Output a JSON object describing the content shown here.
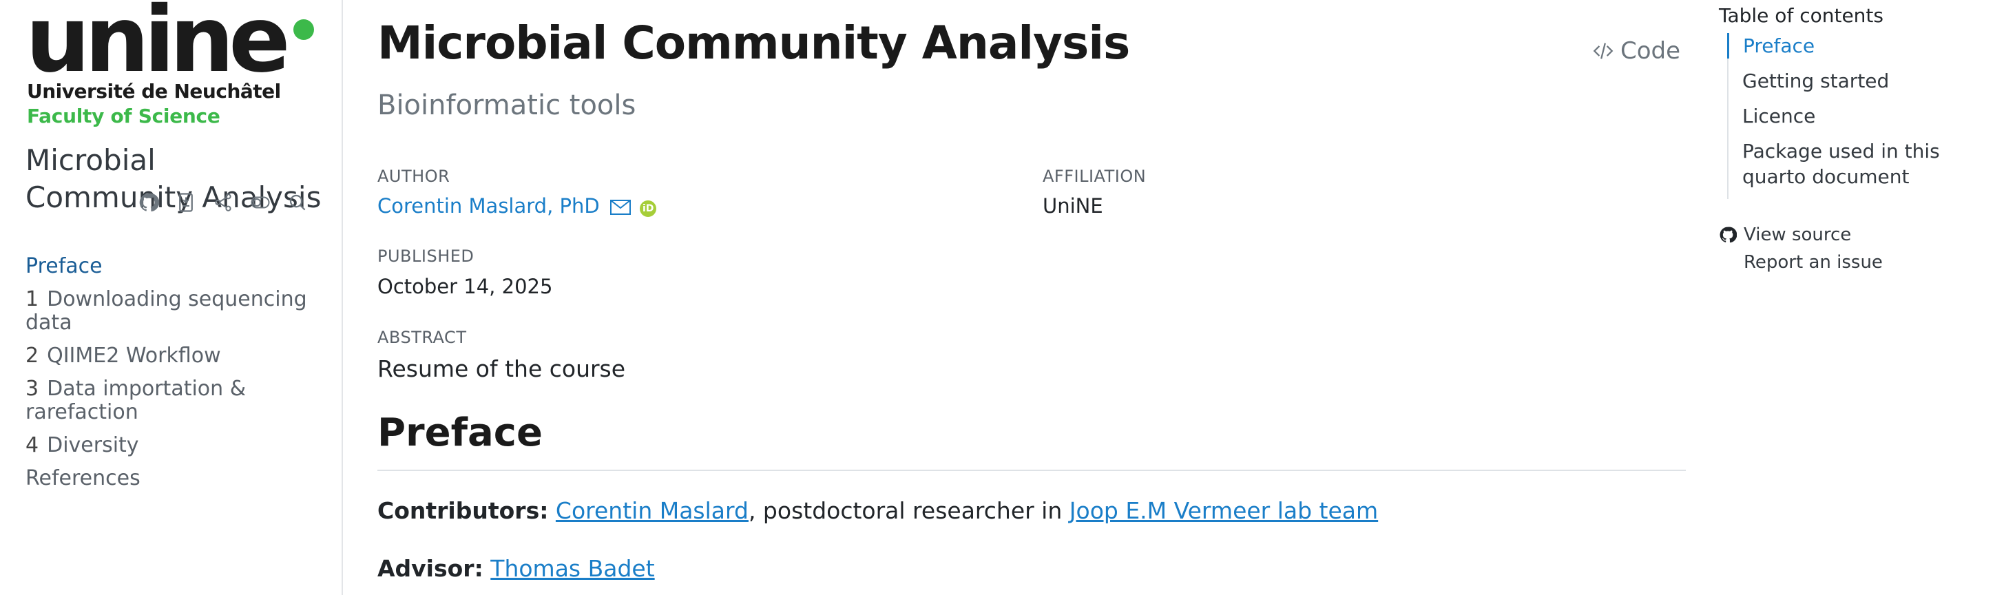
{
  "sidebar": {
    "logo": {
      "word": "unine",
      "university": "Université de Neuchâtel",
      "faculty": "Faculty of Science"
    },
    "title": "Microbial Community Analysis",
    "tools": [
      "github-icon",
      "bookmark-pdf-icon",
      "share-icon",
      "toggle-icon",
      "search-icon"
    ],
    "nav": [
      {
        "num": "",
        "label": "Preface",
        "active": true
      },
      {
        "num": "1",
        "label": "Downloading sequencing data"
      },
      {
        "num": "2",
        "label": "QIIME2 Workflow"
      },
      {
        "num": "3",
        "label": "Data importation & rarefaction"
      },
      {
        "num": "4",
        "label": "Diversity"
      },
      {
        "num": "",
        "label": "References"
      }
    ]
  },
  "main": {
    "title": "Microbial Community Analysis",
    "subtitle": "Bioinformatic tools",
    "code_button": "Code",
    "author_label": "AUTHOR",
    "author": "Corentin Maslard, PhD",
    "affiliation_label": "AFFILIATION",
    "affiliation": "UniNE",
    "published_label": "PUBLISHED",
    "published": "October 14, 2025",
    "abstract_label": "ABSTRACT",
    "abstract": "Resume of the course",
    "section_title": "Preface",
    "contributors_label": "Contributors:",
    "contributor_name": "Corentin Maslard",
    "contributor_role": ", postdoctoral researcher in ",
    "lab_name": "Joop E.M Vermeer lab team",
    "advisor_label": "Advisor:",
    "advisor_name": "Thomas Badet"
  },
  "toc": {
    "title": "Table of contents",
    "items": [
      {
        "label": "Preface",
        "active": true
      },
      {
        "label": "Getting started"
      },
      {
        "label": "Licence"
      },
      {
        "label": "Package used in this quarto document"
      }
    ],
    "view_source": "View source",
    "report_issue": "Report an issue"
  },
  "colors": {
    "accent": "#1a7ec8",
    "active_nav": "#1a5d96",
    "brand_green": "#3cb94a",
    "orcid_green": "#a6ce39"
  }
}
